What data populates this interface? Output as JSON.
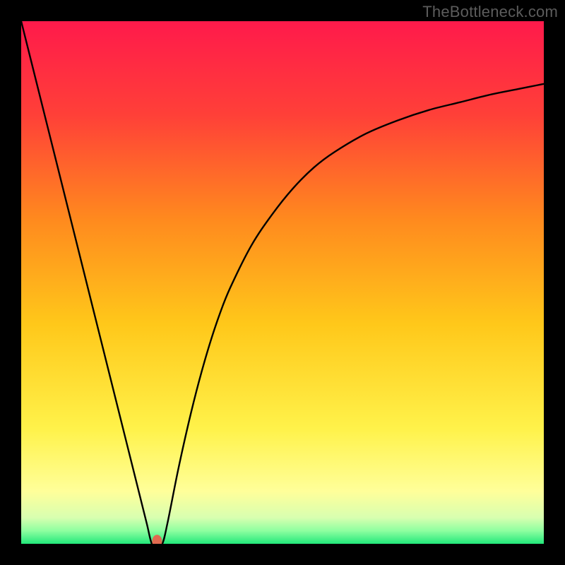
{
  "watermark": "TheBottleneck.com",
  "chart_data": {
    "type": "line",
    "title": "",
    "xlabel": "",
    "ylabel": "",
    "xlim": [
      0,
      100
    ],
    "ylim": [
      0,
      100
    ],
    "grid": false,
    "background_gradient": {
      "stops": [
        {
          "offset": 0.0,
          "color": "#ff1a4b"
        },
        {
          "offset": 0.18,
          "color": "#ff4038"
        },
        {
          "offset": 0.38,
          "color": "#ff8a1e"
        },
        {
          "offset": 0.58,
          "color": "#ffc81a"
        },
        {
          "offset": 0.78,
          "color": "#fff24a"
        },
        {
          "offset": 0.9,
          "color": "#ffff9a"
        },
        {
          "offset": 0.95,
          "color": "#d8ffb0"
        },
        {
          "offset": 0.975,
          "color": "#8effa0"
        },
        {
          "offset": 1.0,
          "color": "#22e87a"
        }
      ]
    },
    "series": [
      {
        "name": "bottleneck-curve",
        "color": "#000000",
        "x": [
          0,
          2,
          4,
          6,
          8,
          10,
          12,
          14,
          16,
          18,
          20,
          22,
          24,
          25,
          26,
          27,
          28,
          30,
          32,
          34,
          36,
          38,
          40,
          44,
          48,
          52,
          56,
          60,
          66,
          72,
          78,
          84,
          90,
          95,
          100
        ],
        "y": [
          100,
          92,
          84,
          76,
          68,
          60,
          52,
          44,
          36,
          28,
          20,
          12,
          4,
          0,
          0,
          0,
          4,
          14,
          23,
          31,
          38,
          44,
          49,
          57,
          63,
          68,
          72,
          75,
          78.5,
          81,
          83,
          84.5,
          86,
          87,
          88
        ]
      }
    ],
    "marker": {
      "name": "optimal-point",
      "x": 26,
      "y": 0.5,
      "color": "#e06a50",
      "rx": 7,
      "ry": 9
    }
  }
}
